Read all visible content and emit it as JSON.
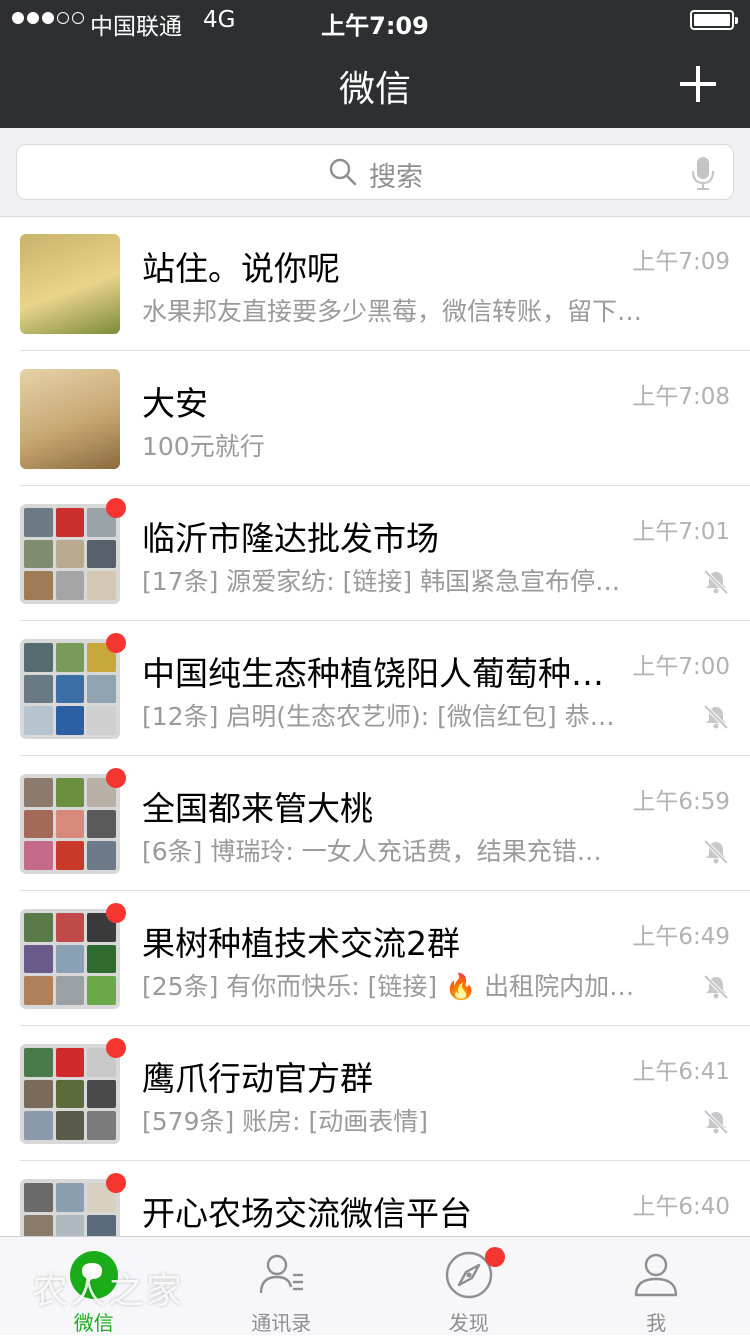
{
  "status_bar": {
    "carrier": "中国联通",
    "network": "4G",
    "time": "上午7:09"
  },
  "nav": {
    "title": "微信",
    "add_icon": "plus-icon"
  },
  "search": {
    "placeholder": "搜索",
    "icon": "search-icon",
    "voice_icon": "mic-icon"
  },
  "chats": [
    {
      "name": "站住。说你呢",
      "time": "上午7:09",
      "preview": "水果邦友直接要多少黑莓，微信转账，留下…",
      "unread": false,
      "muted": false,
      "group": false
    },
    {
      "name": "大安",
      "time": "上午7:08",
      "preview": "100元就行",
      "unread": false,
      "muted": false,
      "group": false
    },
    {
      "name": "临沂市隆达批发市场",
      "time": "上午7:01",
      "preview": "[17条] 源爱家纺: [链接] 韩国紧急宣布停…",
      "unread": true,
      "muted": true,
      "group": true
    },
    {
      "name": "中国纯生态种植饶阳人葡萄种…",
      "time": "上午7:00",
      "preview": "[12条] 启明(生态农艺师): [微信红包] 恭…",
      "unread": true,
      "muted": true,
      "group": true
    },
    {
      "name": "全国都来管大桃",
      "time": "上午6:59",
      "preview": "[6条] 博瑞玲: 一女人充话费，结果充错…",
      "unread": true,
      "muted": true,
      "group": true
    },
    {
      "name": "果树种植技术交流2群",
      "time": "上午6:49",
      "preview": "[25条] 有你而快乐: [链接] 🔥 出租院内加…",
      "unread": true,
      "muted": true,
      "group": true
    },
    {
      "name": "鹰爪行动官方群",
      "time": "上午6:41",
      "preview": "[579条] 账房: [动画表情]",
      "unread": true,
      "muted": true,
      "group": true
    },
    {
      "name": "开心农场交流微信平台",
      "time": "上午6:40",
      "preview": "",
      "unread": true,
      "muted": true,
      "group": true
    }
  ],
  "tabbar": {
    "tabs": [
      {
        "label": "微信",
        "icon": "chat-icon",
        "active": true,
        "dot": false
      },
      {
        "label": "通讯录",
        "icon": "contacts-icon",
        "active": false,
        "dot": false
      },
      {
        "label": "发现",
        "icon": "compass-icon",
        "active": false,
        "dot": true
      },
      {
        "label": "我",
        "icon": "profile-icon",
        "active": false,
        "dot": false
      }
    ]
  },
  "watermark": "农人之家",
  "colors": {
    "nav_bg": "#2e2f33",
    "accent_green": "#1aad19",
    "badge_red": "#f43530",
    "secondary_text": "#9a9a9a"
  }
}
